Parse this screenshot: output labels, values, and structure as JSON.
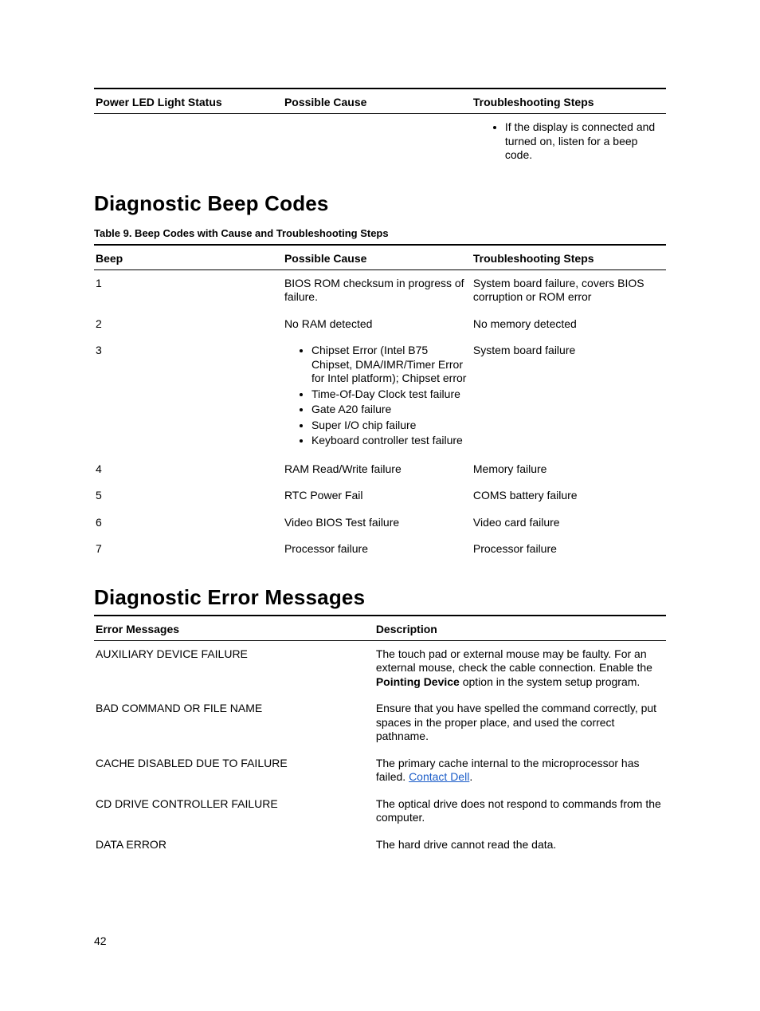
{
  "page_number": "42",
  "led_table": {
    "headers": [
      "Power LED Light Status",
      "Possible Cause",
      "Troubleshooting Steps"
    ],
    "row": {
      "status": "",
      "cause": "",
      "ts_item": "If the display is connected and turned on, listen for a beep code."
    }
  },
  "beep_section": {
    "title": "Diagnostic Beep Codes",
    "caption": "Table 9. Beep Codes with Cause and Troubleshooting Steps",
    "headers": [
      "Beep",
      "Possible Cause",
      "Troubleshooting Steps"
    ],
    "rows": [
      {
        "beep": "1",
        "cause": "BIOS ROM checksum in progress of failure.",
        "ts": "System board failure, covers BIOS corruption or ROM error"
      },
      {
        "beep": "2",
        "cause": "No RAM detected",
        "ts": "No memory detected"
      },
      {
        "beep": "3",
        "cause_list": [
          "Chipset Error (Intel B75 Chipset, DMA/IMR/Timer Error for Intel platform); Chipset error",
          "Time-Of-Day Clock test failure",
          "Gate A20 failure",
          "Super I/O chip failure",
          "Keyboard controller test failure"
        ],
        "ts": "System board failure"
      },
      {
        "beep": "4",
        "cause": "RAM Read/Write failure",
        "ts": "Memory failure"
      },
      {
        "beep": "5",
        "cause": "RTC Power Fail",
        "ts": "COMS battery failure"
      },
      {
        "beep": "6",
        "cause": "Video BIOS Test failure",
        "ts": "Video card failure"
      },
      {
        "beep": "7",
        "cause": "Processor failure",
        "ts": "Processor failure"
      }
    ]
  },
  "err_section": {
    "title": "Diagnostic Error Messages",
    "headers": [
      "Error Messages",
      "Description"
    ],
    "rows": [
      {
        "msg": "AUXILIARY DEVICE FAILURE",
        "desc_prefix": "The touch pad or external mouse may be faulty. For an external mouse, check the cable connection. Enable the ",
        "desc_bold": "Pointing Device",
        "desc_suffix": " option in the system setup program."
      },
      {
        "msg": "BAD COMMAND OR FILE NAME",
        "desc": "Ensure that you have spelled the command correctly, put spaces in the proper place, and used the correct pathname."
      },
      {
        "msg": "CACHE DISABLED DUE TO FAILURE",
        "desc_prefix": "The primary cache internal to the microprocessor has failed. ",
        "link_text": "Contact Dell",
        "desc_suffix": "."
      },
      {
        "msg": "CD DRIVE CONTROLLER FAILURE",
        "desc": "The optical drive does not respond to commands from the computer."
      },
      {
        "msg": "DATA ERROR",
        "desc": "The hard drive cannot read the data."
      }
    ]
  }
}
